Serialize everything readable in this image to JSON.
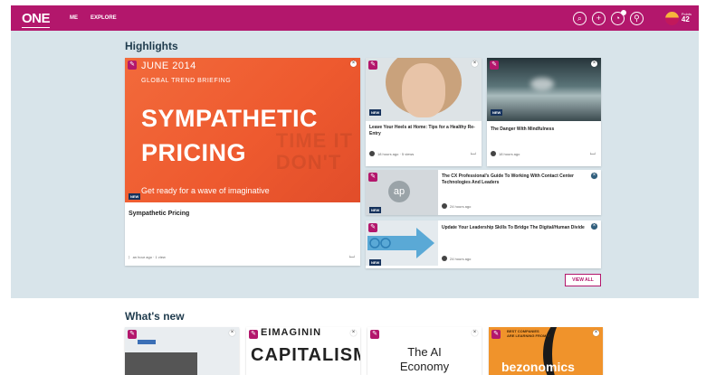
{
  "header": {
    "logo": "ONE",
    "nav": [
      "ME",
      "EXPLORE"
    ],
    "icons": [
      "search-icon",
      "add-icon",
      "notifications-icon",
      "location-icon"
    ],
    "points_label": "Points",
    "points_value": "42",
    "brand_color": "#b3176c"
  },
  "highlights": {
    "title": "Highlights",
    "hero": {
      "image_date": "JUNE 2014",
      "image_subtitle": "GLOBAL TREND BRIEFING",
      "image_title_1": "SYMPATHETIC",
      "image_title_2": "PRICING",
      "image_tagline": "Get ready for a wave of imaginative",
      "badge": "NEW",
      "title": "Sympathetic Pricing",
      "meta": "an hour ago · 1 view"
    },
    "card_heels": {
      "badge": "NEW",
      "title": "Leave Your Heels at Home: Tips for a Healthy Re-Entry",
      "meta": "18 hours ago · 5 views"
    },
    "card_mindfulness": {
      "badge": "NEW",
      "title": "The Danger With Mindfulness",
      "meta": "18 hours ago"
    },
    "card_cx": {
      "badge": "NEW",
      "image_text": "ap",
      "title": "The CX Professional's Guide To Working With Contact Center Technologies And Leaders",
      "meta": "24 hours ago"
    },
    "card_leadership": {
      "badge": "NEW",
      "title": "Update Your Leadership Skills To Bridge The Digital/Human Divide",
      "meta": "24 hours ago"
    },
    "view_all": "VIEW ALL"
  },
  "whats_new": {
    "title": "What's new",
    "cards": [
      {
        "text": ""
      },
      {
        "top": "EIMAGININ",
        "text": "CAPITALISM"
      },
      {
        "line1": "The AI",
        "line2": "Economy"
      },
      {
        "small_1": "BEST COMPANIES",
        "small_2": "ARE LEARNING FROM IT",
        "title": "bezonomics"
      }
    ]
  }
}
